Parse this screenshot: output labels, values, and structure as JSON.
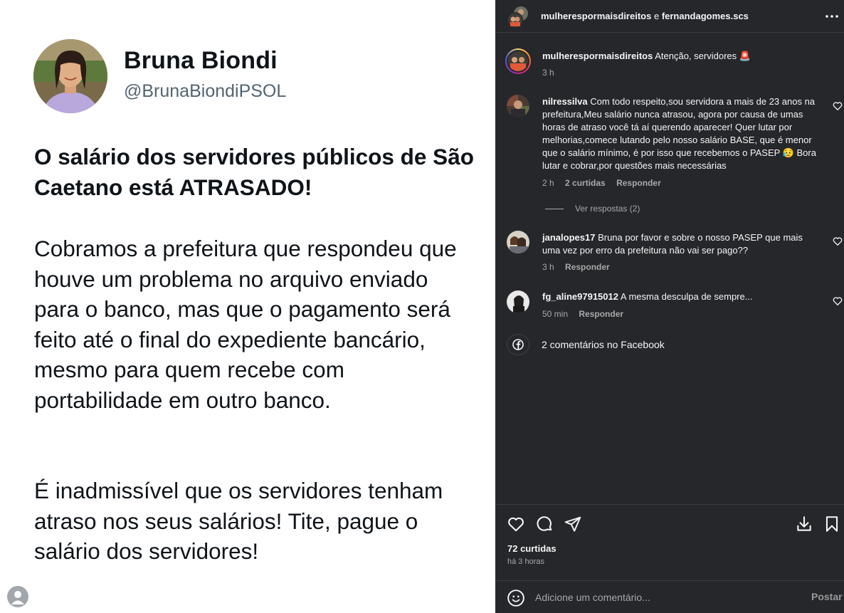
{
  "tweet": {
    "name": "Bruna Biondi",
    "handle": "@BrunaBiondiPSOL",
    "paragraphs": [
      "O salário dos servidores públicos de São Caetano está ATRASADO!",
      "Cobramos a prefeitura que respondeu que houve um problema no arquivo enviado para o banco, mas que o pagamento será feito até o final do expediente bancário, mesmo para quem recebe com portabilidade em outro banco.",
      "É inadmissível que os servidores tenham atraso nos seus salários! Tite, pague o salário dos servidores!"
    ]
  },
  "header": {
    "user1": "mulherespormaisdireitos",
    "joiner": "e",
    "user2": "fernandagomes.scs",
    "more_icon": "more-horizontal-icon"
  },
  "caption": {
    "username": "mulherespormaisdireitos",
    "text": "Atenção, servidores 🚨",
    "time": "3 h"
  },
  "comments": [
    {
      "username": "nilressilva",
      "text": "Com todo respeito,sou servidora a mais de 23 anos na prefeitura,Meu salário nunca atrasou, agora por causa de umas horas de atraso você tá aí querendo aparecer! Quer lutar por melhorias,comece lutando pelo nosso salário BASE, que é menor que o salário mínimo, é por isso que recebemos o PASEP 😥 Bora lutar e cobrar,por questões mais necessárias",
      "time": "2 h",
      "likes": "2 curtidas",
      "reply": "Responder"
    },
    {
      "username": "janalopes17",
      "text": "Bruna por favor e sobre o nosso PASEP que mais uma vez por erro da prefeitura não vai ser pago??",
      "time": "3 h",
      "reply": "Responder"
    },
    {
      "username": "fg_aline97915012",
      "text": "A mesma desculpa de sempre...",
      "time": "50 min",
      "reply": "Responder"
    }
  ],
  "view_replies": "Ver respostas (2)",
  "facebook_comments": "2 comentários no Facebook",
  "actions": {
    "icons": [
      "heart-icon",
      "comment-icon",
      "share-icon",
      "download-icon",
      "bookmark-icon"
    ]
  },
  "likes_count": "72 curtidas",
  "posted_time": "há 3 horas",
  "comment_box": {
    "placeholder": "Adicione um comentário...",
    "post_label": "Postar"
  },
  "colors": {
    "panel_bg": "#26272b",
    "text_primary": "#f5f5f5",
    "text_secondary": "#a8a8a8",
    "tweet_text": "#0f1419",
    "tweet_handle": "#536471"
  }
}
